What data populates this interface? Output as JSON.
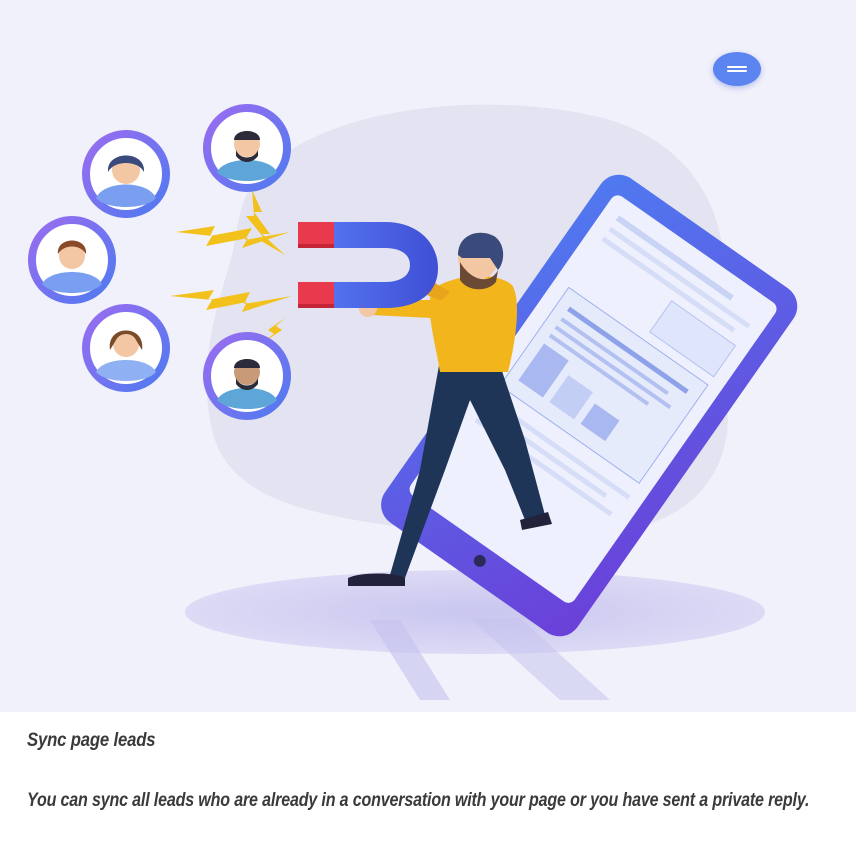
{
  "illustration": {
    "icon": "lead-magnet-illustration",
    "colors": {
      "background": "#f1f1fb",
      "blob": "#e3e3f1",
      "phone_frame": "#5a48e0",
      "accent_blue": "#5b84f0",
      "shirt": "#f2b51c",
      "pants": "#1f3557",
      "magnet_blue": "#4a62e8",
      "magnet_red": "#e83a4c",
      "lightning": "#f2c11c",
      "avatar_ring": "#7b5de8"
    }
  },
  "menu_button": {
    "icon": "hamburger-menu-icon"
  },
  "caption": {
    "title": "Sync page leads",
    "description": "You can sync all leads who are already in a conversation with your page or you have sent a private reply."
  }
}
